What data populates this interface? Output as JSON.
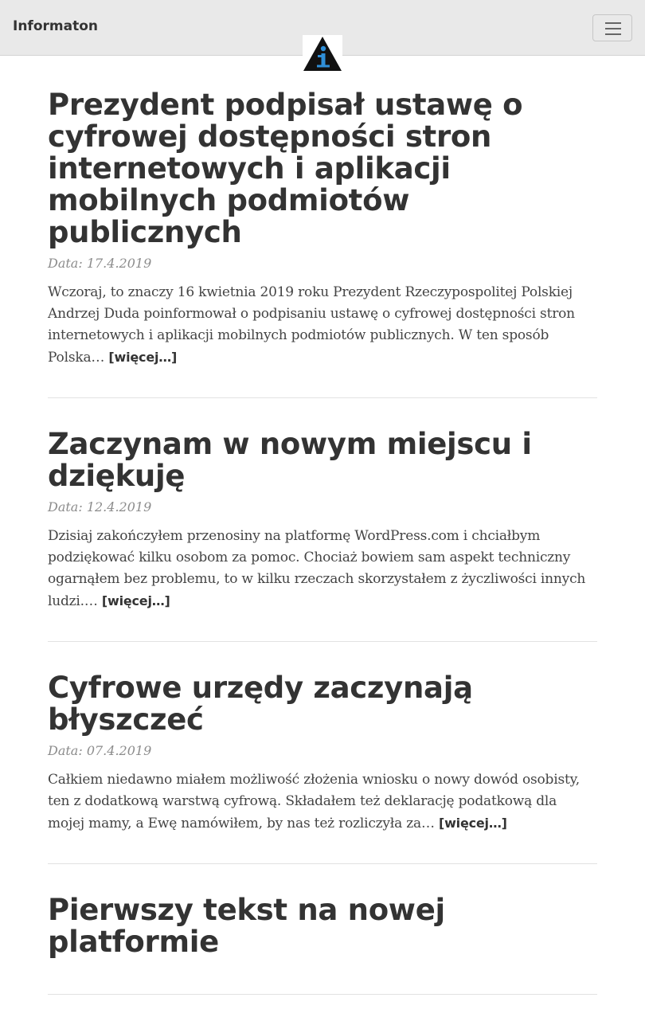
{
  "header": {
    "brand": "Informaton",
    "logo_icon": "info-triangle-logo",
    "menu_icon": "hamburger-icon",
    "colors": {
      "nav_bg": "#e9e9e9",
      "logo_blue": "#2f8fd8"
    }
  },
  "posts": [
    {
      "title": "Prezydent podpisał ustawę o cyfrowej dostępności stron internetowych i aplikacji mobilnych podmiotów publicznych",
      "date": "Data: 17.4.2019",
      "excerpt": "Wczoraj, to znaczy 16 kwietnia 2019 roku Prezydent Rzeczypospolitej Polskiej Andrzej Duda poinformował o podpisaniu ustawę o cyfrowej dostępności stron internetowych i aplikacji mobilnych podmiotów publicznych. W ten sposób Polska…",
      "more": "[więcej…]"
    },
    {
      "title": "Zaczynam w nowym miejscu i dziękuję",
      "date": "Data: 12.4.2019",
      "excerpt": "Dzisiaj zakończyłem przenosiny na platformę WordPress.com i chciałbym podziękować kilku osobom za pomoc. Chociaż bowiem sam aspekt techniczny ogarnąłem bez problemu, to w kilku rzeczach skorzystałem z życzliwości innych ludzi.…",
      "more": "[więcej…]"
    },
    {
      "title": "Cyfrowe urzędy zaczynają błyszczeć",
      "date": "Data: 07.4.2019",
      "excerpt": "Całkiem niedawno miałem możliwość złożenia wniosku o nowy dowód osobisty, ten z dodatkową warstwą cyfrową. Składałem też deklarację podatkową dla mojej mamy, a Ewę namówiłem, by nas też rozliczyła za…",
      "more": "[więcej…]"
    },
    {
      "title": "Pierwszy tekst na nowej platformie"
    }
  ]
}
